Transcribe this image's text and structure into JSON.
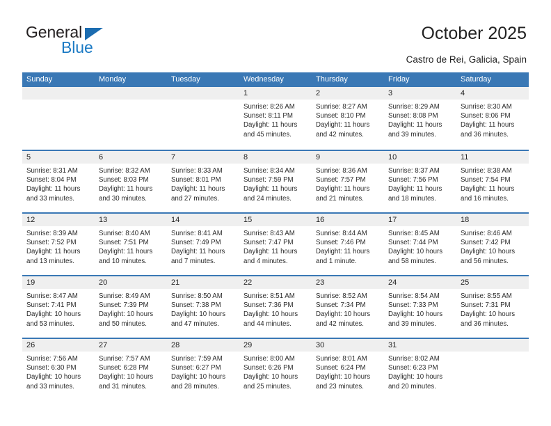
{
  "brand": {
    "name_part1": "General",
    "name_part2": "Blue",
    "triangle_color": "#1b6cb0",
    "blue_color": "#1b7ac4"
  },
  "header": {
    "title": "October 2025",
    "location": "Castro de Rei, Galicia, Spain"
  },
  "theme": {
    "header_blue": "#3a78b5",
    "daynum_band": "#efefef",
    "text": "#222222"
  },
  "calendar": {
    "weekdays": [
      "Sunday",
      "Monday",
      "Tuesday",
      "Wednesday",
      "Thursday",
      "Friday",
      "Saturday"
    ],
    "weeks": [
      [
        {
          "day": "",
          "lines": []
        },
        {
          "day": "",
          "lines": []
        },
        {
          "day": "",
          "lines": []
        },
        {
          "day": "1",
          "lines": [
            "Sunrise: 8:26 AM",
            "Sunset: 8:11 PM",
            "Daylight: 11 hours",
            "and 45 minutes."
          ]
        },
        {
          "day": "2",
          "lines": [
            "Sunrise: 8:27 AM",
            "Sunset: 8:10 PM",
            "Daylight: 11 hours",
            "and 42 minutes."
          ]
        },
        {
          "day": "3",
          "lines": [
            "Sunrise: 8:29 AM",
            "Sunset: 8:08 PM",
            "Daylight: 11 hours",
            "and 39 minutes."
          ]
        },
        {
          "day": "4",
          "lines": [
            "Sunrise: 8:30 AM",
            "Sunset: 8:06 PM",
            "Daylight: 11 hours",
            "and 36 minutes."
          ]
        }
      ],
      [
        {
          "day": "5",
          "lines": [
            "Sunrise: 8:31 AM",
            "Sunset: 8:04 PM",
            "Daylight: 11 hours",
            "and 33 minutes."
          ]
        },
        {
          "day": "6",
          "lines": [
            "Sunrise: 8:32 AM",
            "Sunset: 8:03 PM",
            "Daylight: 11 hours",
            "and 30 minutes."
          ]
        },
        {
          "day": "7",
          "lines": [
            "Sunrise: 8:33 AM",
            "Sunset: 8:01 PM",
            "Daylight: 11 hours",
            "and 27 minutes."
          ]
        },
        {
          "day": "8",
          "lines": [
            "Sunrise: 8:34 AM",
            "Sunset: 7:59 PM",
            "Daylight: 11 hours",
            "and 24 minutes."
          ]
        },
        {
          "day": "9",
          "lines": [
            "Sunrise: 8:36 AM",
            "Sunset: 7:57 PM",
            "Daylight: 11 hours",
            "and 21 minutes."
          ]
        },
        {
          "day": "10",
          "lines": [
            "Sunrise: 8:37 AM",
            "Sunset: 7:56 PM",
            "Daylight: 11 hours",
            "and 18 minutes."
          ]
        },
        {
          "day": "11",
          "lines": [
            "Sunrise: 8:38 AM",
            "Sunset: 7:54 PM",
            "Daylight: 11 hours",
            "and 16 minutes."
          ]
        }
      ],
      [
        {
          "day": "12",
          "lines": [
            "Sunrise: 8:39 AM",
            "Sunset: 7:52 PM",
            "Daylight: 11 hours",
            "and 13 minutes."
          ]
        },
        {
          "day": "13",
          "lines": [
            "Sunrise: 8:40 AM",
            "Sunset: 7:51 PM",
            "Daylight: 11 hours",
            "and 10 minutes."
          ]
        },
        {
          "day": "14",
          "lines": [
            "Sunrise: 8:41 AM",
            "Sunset: 7:49 PM",
            "Daylight: 11 hours",
            "and 7 minutes."
          ]
        },
        {
          "day": "15",
          "lines": [
            "Sunrise: 8:43 AM",
            "Sunset: 7:47 PM",
            "Daylight: 11 hours",
            "and 4 minutes."
          ]
        },
        {
          "day": "16",
          "lines": [
            "Sunrise: 8:44 AM",
            "Sunset: 7:46 PM",
            "Daylight: 11 hours",
            "and 1 minute."
          ]
        },
        {
          "day": "17",
          "lines": [
            "Sunrise: 8:45 AM",
            "Sunset: 7:44 PM",
            "Daylight: 10 hours",
            "and 58 minutes."
          ]
        },
        {
          "day": "18",
          "lines": [
            "Sunrise: 8:46 AM",
            "Sunset: 7:42 PM",
            "Daylight: 10 hours",
            "and 56 minutes."
          ]
        }
      ],
      [
        {
          "day": "19",
          "lines": [
            "Sunrise: 8:47 AM",
            "Sunset: 7:41 PM",
            "Daylight: 10 hours",
            "and 53 minutes."
          ]
        },
        {
          "day": "20",
          "lines": [
            "Sunrise: 8:49 AM",
            "Sunset: 7:39 PM",
            "Daylight: 10 hours",
            "and 50 minutes."
          ]
        },
        {
          "day": "21",
          "lines": [
            "Sunrise: 8:50 AM",
            "Sunset: 7:38 PM",
            "Daylight: 10 hours",
            "and 47 minutes."
          ]
        },
        {
          "day": "22",
          "lines": [
            "Sunrise: 8:51 AM",
            "Sunset: 7:36 PM",
            "Daylight: 10 hours",
            "and 44 minutes."
          ]
        },
        {
          "day": "23",
          "lines": [
            "Sunrise: 8:52 AM",
            "Sunset: 7:34 PM",
            "Daylight: 10 hours",
            "and 42 minutes."
          ]
        },
        {
          "day": "24",
          "lines": [
            "Sunrise: 8:54 AM",
            "Sunset: 7:33 PM",
            "Daylight: 10 hours",
            "and 39 minutes."
          ]
        },
        {
          "day": "25",
          "lines": [
            "Sunrise: 8:55 AM",
            "Sunset: 7:31 PM",
            "Daylight: 10 hours",
            "and 36 minutes."
          ]
        }
      ],
      [
        {
          "day": "26",
          "lines": [
            "Sunrise: 7:56 AM",
            "Sunset: 6:30 PM",
            "Daylight: 10 hours",
            "and 33 minutes."
          ]
        },
        {
          "day": "27",
          "lines": [
            "Sunrise: 7:57 AM",
            "Sunset: 6:28 PM",
            "Daylight: 10 hours",
            "and 31 minutes."
          ]
        },
        {
          "day": "28",
          "lines": [
            "Sunrise: 7:59 AM",
            "Sunset: 6:27 PM",
            "Daylight: 10 hours",
            "and 28 minutes."
          ]
        },
        {
          "day": "29",
          "lines": [
            "Sunrise: 8:00 AM",
            "Sunset: 6:26 PM",
            "Daylight: 10 hours",
            "and 25 minutes."
          ]
        },
        {
          "day": "30",
          "lines": [
            "Sunrise: 8:01 AM",
            "Sunset: 6:24 PM",
            "Daylight: 10 hours",
            "and 23 minutes."
          ]
        },
        {
          "day": "31",
          "lines": [
            "Sunrise: 8:02 AM",
            "Sunset: 6:23 PM",
            "Daylight: 10 hours",
            "and 20 minutes."
          ]
        },
        {
          "day": "",
          "lines": []
        }
      ]
    ]
  }
}
